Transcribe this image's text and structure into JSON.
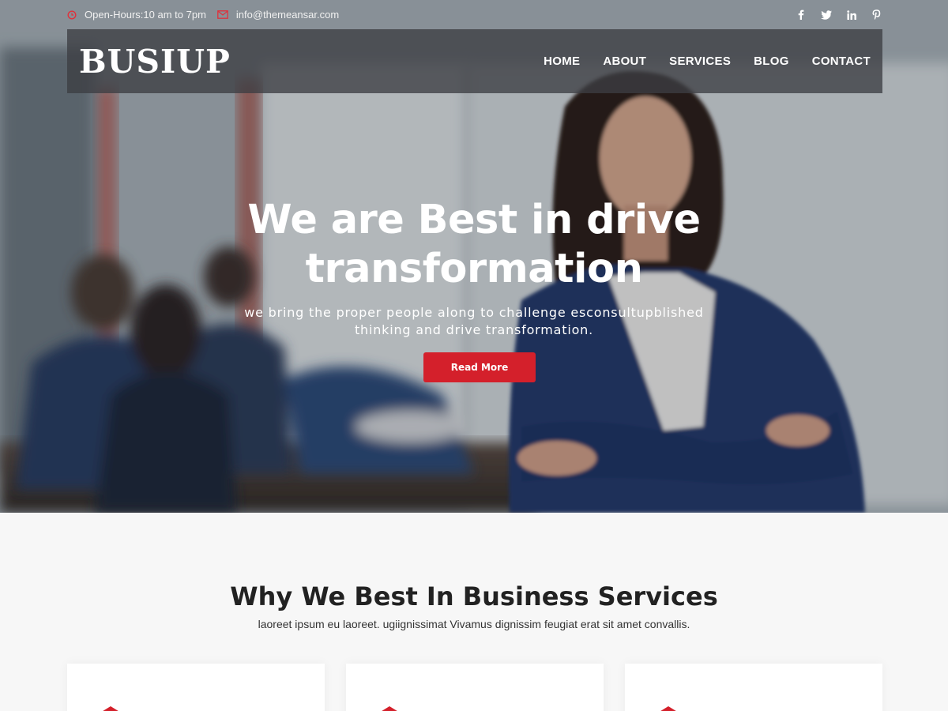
{
  "topbar": {
    "hours": "Open-Hours:10 am to 7pm",
    "email": "info@themeansar.com",
    "socials": [
      "facebook-icon",
      "twitter-icon",
      "linkedin-icon",
      "pinterest-icon"
    ]
  },
  "nav": {
    "logo": "BUSIUP",
    "items": [
      "HOME",
      "ABOUT",
      "SERVICES",
      "BLOG",
      "CONTACT"
    ]
  },
  "hero": {
    "title_line1": "We are Best in drive",
    "title_line2": "transformation",
    "subtitle_line1": "we bring the proper people along to challenge esconsultupblished",
    "subtitle_line2": "thinking and drive transformation.",
    "button": "Read More"
  },
  "services": {
    "title": "Why We Best In Business Services",
    "subtitle": "laoreet ipsum eu laoreet. ugiignissimat Vivamus dignissim feugiat erat sit amet convallis."
  },
  "colors": {
    "accent": "#d4202b",
    "nav_bg": "#3c3e42",
    "section_bg": "#f7f7f7"
  }
}
